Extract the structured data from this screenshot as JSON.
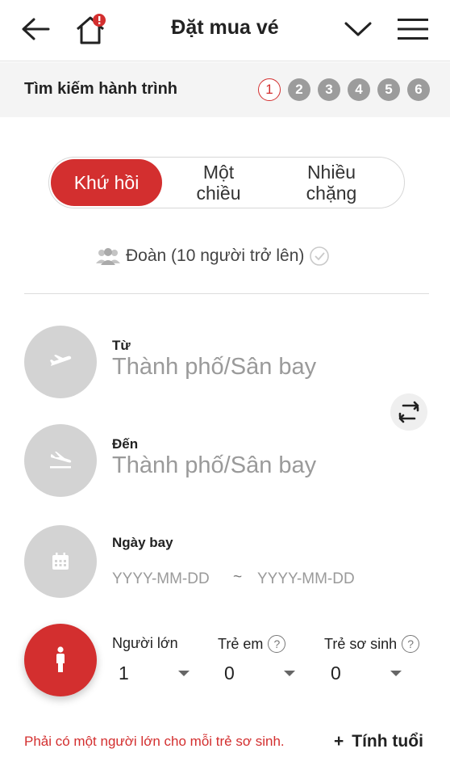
{
  "header": {
    "title": "Đặt mua vé",
    "icons": {
      "back": "arrow-left-icon",
      "home": "home-icon",
      "dropdown": "chevron-down-icon",
      "menu": "hamburger-icon"
    },
    "home_badge_color": "#d32f2f"
  },
  "stepbar": {
    "title": "Tìm kiếm hành trình",
    "steps": [
      "1",
      "2",
      "3",
      "4",
      "5",
      "6"
    ],
    "active_step": "1"
  },
  "trip_type": {
    "options": [
      "Khứ hồi",
      "Một chiều",
      "Nhiều chặng"
    ],
    "selected": "Khứ hồi"
  },
  "group": {
    "label": "Đoàn (10 người trở lên)",
    "checked": false
  },
  "from": {
    "label": "Từ",
    "placeholder": "Thành phố/Sân bay"
  },
  "to": {
    "label": "Đến",
    "placeholder": "Thành phố/Sân bay"
  },
  "date": {
    "label": "Ngày bay",
    "depart_placeholder": "YYYY-MM-DD",
    "separator": "~",
    "return_placeholder": "YYYY-MM-DD"
  },
  "passengers": {
    "adult": {
      "label": "Người lớn",
      "value": "1"
    },
    "child": {
      "label": "Trẻ em",
      "value": "0",
      "help": "?"
    },
    "infant": {
      "label": "Trẻ sơ sinh",
      "value": "0",
      "help": "?"
    }
  },
  "notice": "Phải có một người lớn cho mỗi trẻ sơ sinh.",
  "age_calc": {
    "plus": "+",
    "label": "Tính tuổi"
  },
  "colors": {
    "accent": "#d32f2f",
    "inactive_circle": "#d3d3d3",
    "step_inactive": "#9c9c9c"
  }
}
